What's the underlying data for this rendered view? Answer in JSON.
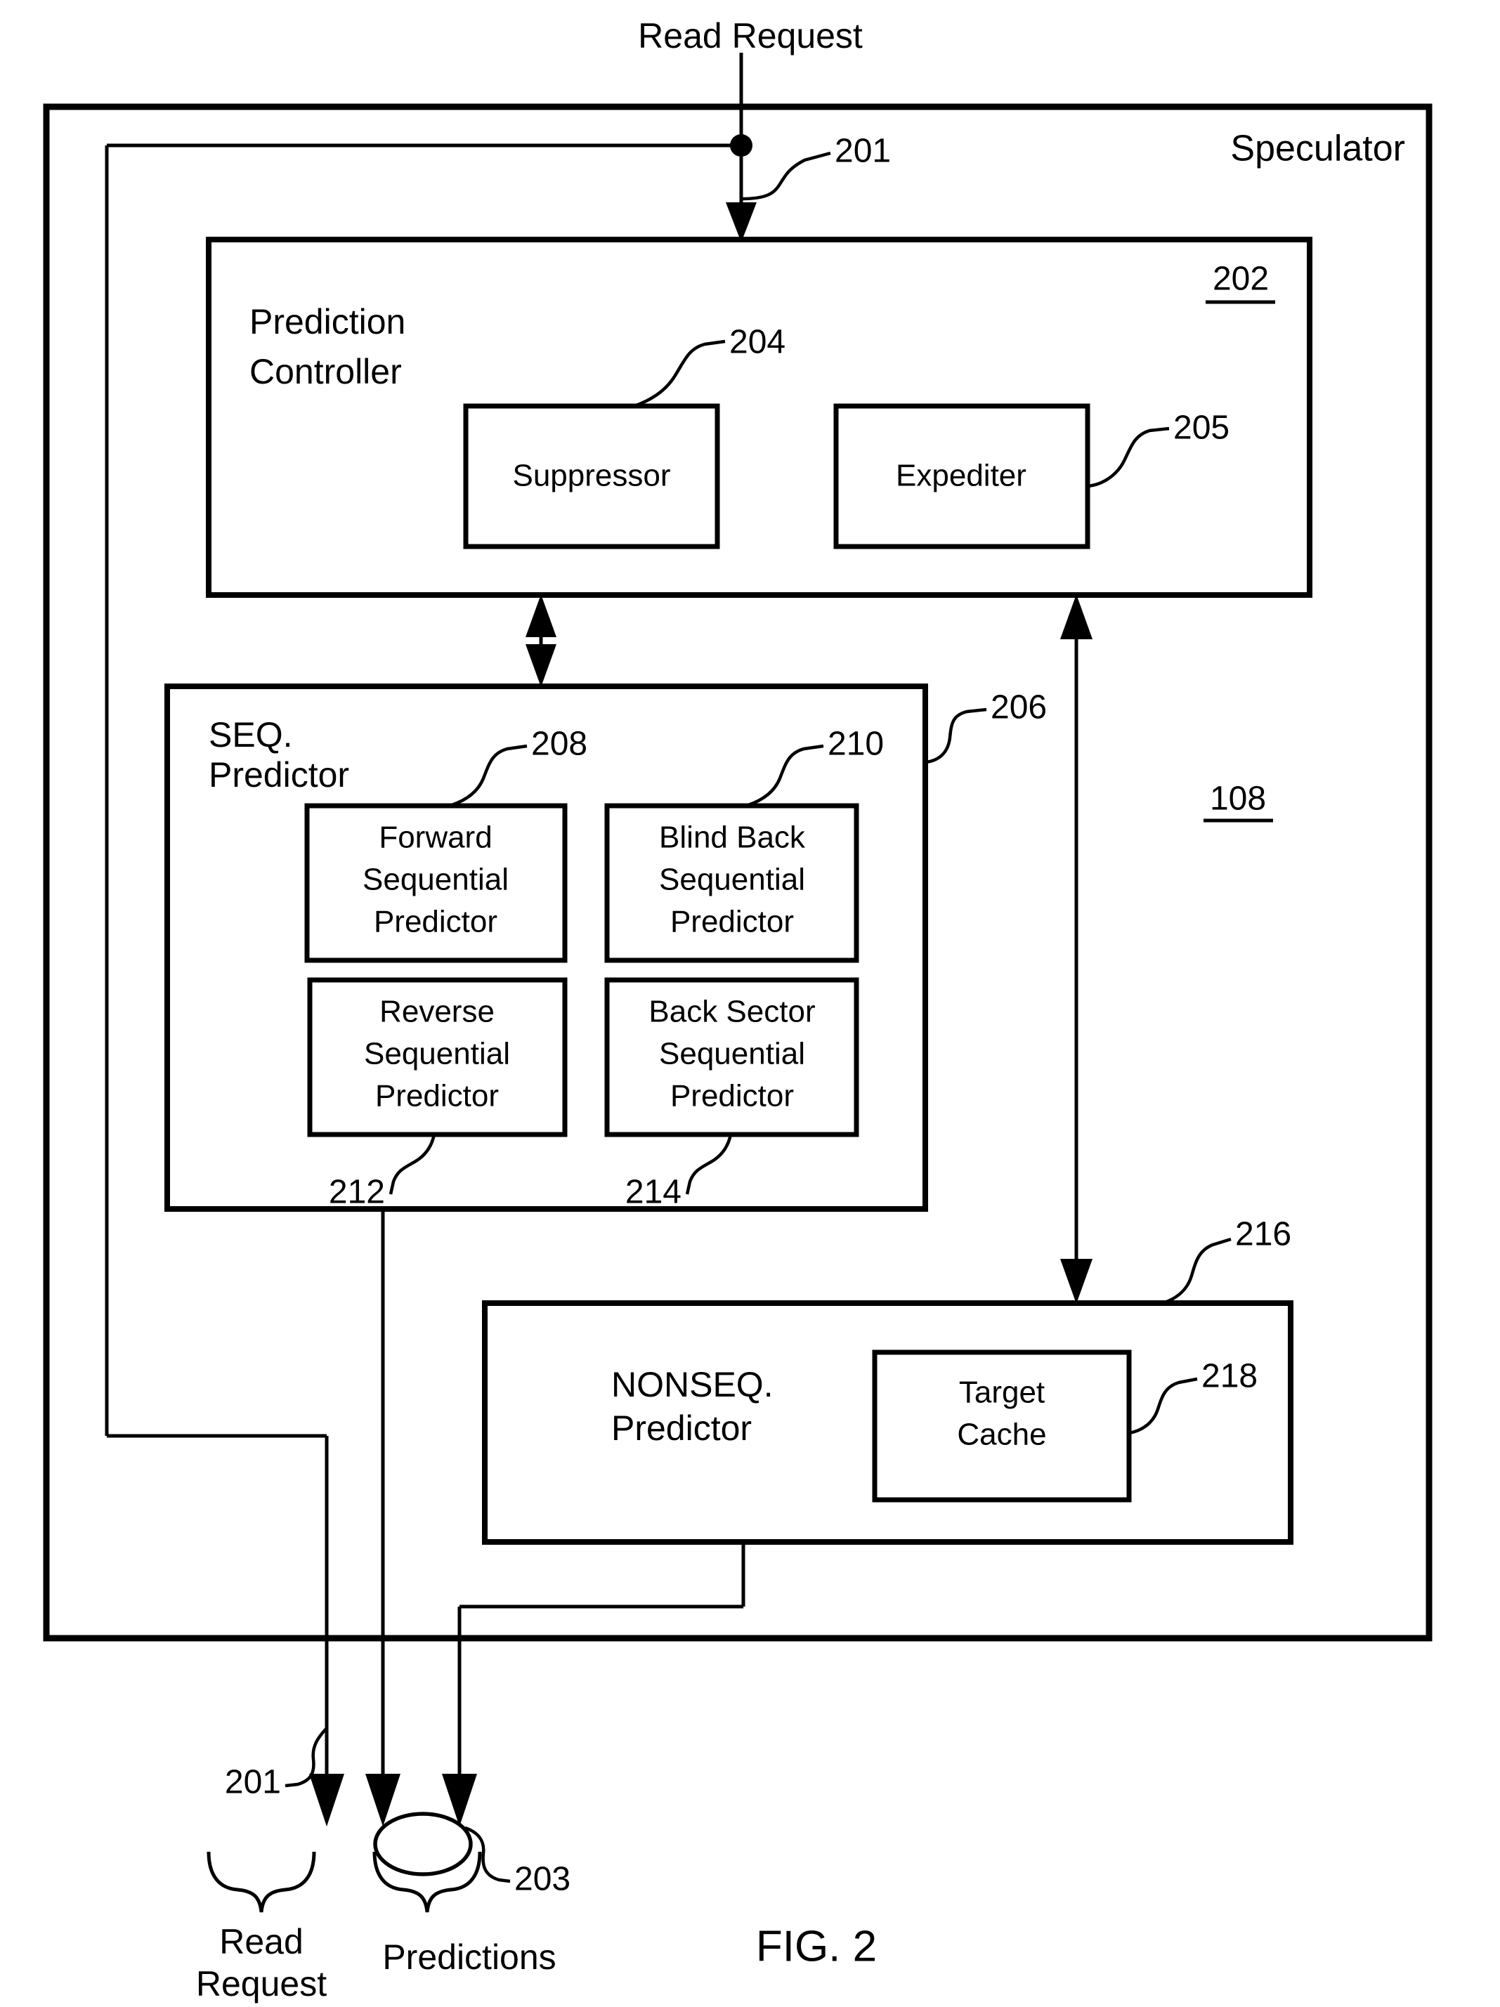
{
  "figure": {
    "caption": "FIG. 2",
    "top_label": "Read Request",
    "outer_box_label": "Speculator",
    "outer_box_ref": "108"
  },
  "boxes": {
    "prediction_controller": {
      "title_line1": "Prediction",
      "title_line2": "Controller",
      "ref": "202",
      "children": [
        {
          "label": "Suppressor",
          "ref": "204"
        },
        {
          "label": "Expediter",
          "ref": "205"
        }
      ]
    },
    "seq_predictor": {
      "title_line1": "SEQ.",
      "title_line2": "Predictor",
      "ref": "206",
      "children": [
        {
          "label_line1": "Forward",
          "label_line2": "Sequential",
          "label_line3": "Predictor",
          "ref": "208"
        },
        {
          "label_line1": "Blind Back",
          "label_line2": "Sequential",
          "label_line3": "Predictor",
          "ref": "210"
        },
        {
          "label_line1": "Reverse",
          "label_line2": "Sequential",
          "label_line3": "Predictor",
          "ref": "212"
        },
        {
          "label_line1": "Back Sector",
          "label_line2": "Sequential",
          "label_line3": "Predictor",
          "ref": "214"
        }
      ]
    },
    "nonseq_predictor": {
      "title_line1": "NONSEQ.",
      "title_line2": "Predictor",
      "ref": "216",
      "children": [
        {
          "label_line1": "Target",
          "label_line2": "Cache",
          "ref": "218"
        }
      ]
    }
  },
  "signals": {
    "read_request_in_ref": "201",
    "read_request_out_ref": "201",
    "predictions_ref": "203",
    "read_request_out_line1": "Read",
    "read_request_out_line2": "Request",
    "predictions_label": "Predictions"
  },
  "colors": {
    "ink": "#000000",
    "paper": "#ffffff"
  }
}
